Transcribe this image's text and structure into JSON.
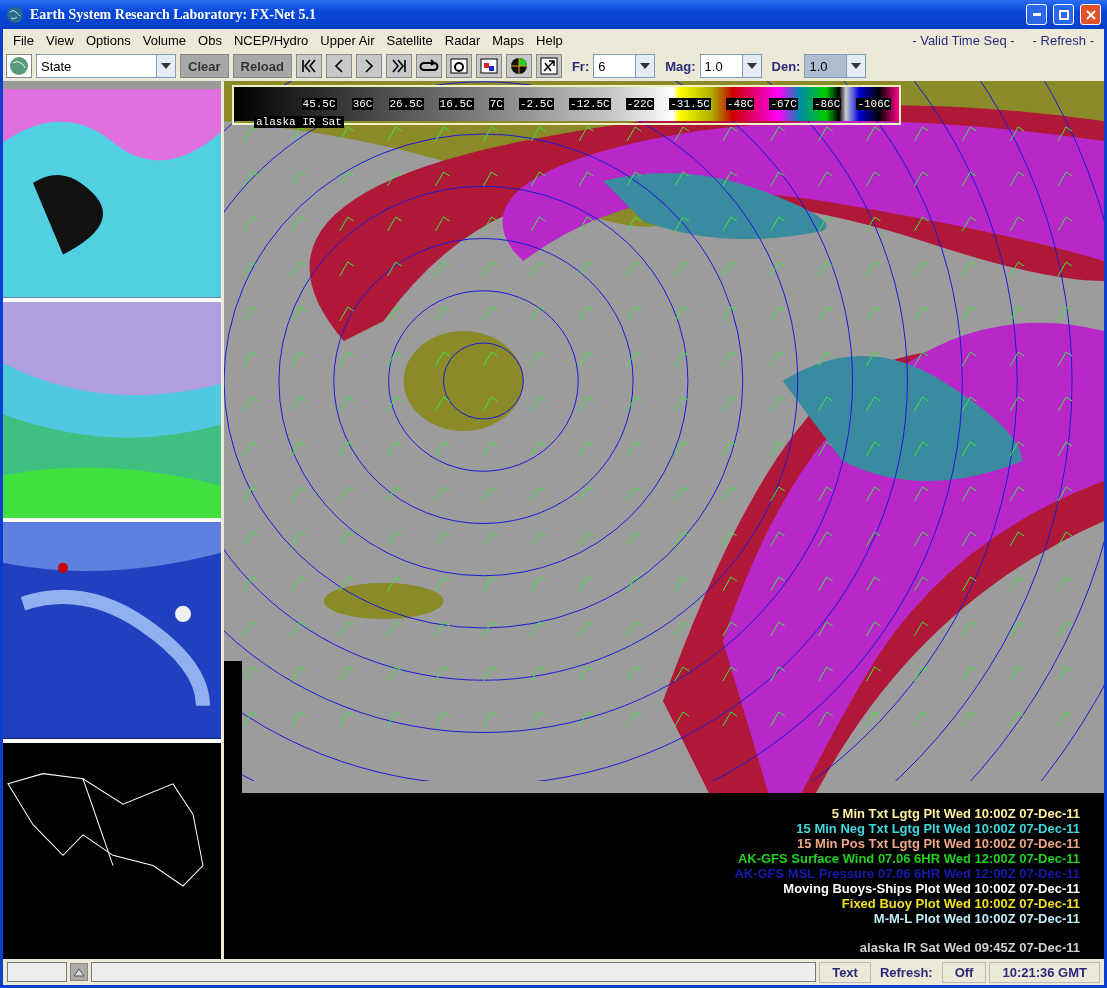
{
  "window": {
    "title": "Earth System Research Laboratory: FX-Net 5.1"
  },
  "menu": {
    "items": [
      "File",
      "View",
      "Options",
      "Volume",
      "Obs",
      "NCEP/Hydro",
      "Upper Air",
      "Satellite",
      "Radar",
      "Maps",
      "Help"
    ],
    "right": [
      "- Valid Time Seq -",
      "- Refresh -"
    ]
  },
  "toolbar": {
    "region": "State",
    "buttons": [
      "Clear",
      "Reload"
    ],
    "selectors": [
      {
        "label": "Fr:",
        "value": "6",
        "highlighted": false
      },
      {
        "label": "Mag:",
        "value": "1.0",
        "highlighted": false
      },
      {
        "label": "Den:",
        "value": "1.0",
        "highlighted": true
      }
    ]
  },
  "thumbnails": [
    {
      "kind": "wind"
    },
    {
      "kind": "temperature"
    },
    {
      "kind": "surface"
    },
    {
      "kind": "outline"
    }
  ],
  "map": {
    "colorbar": {
      "labels": [
        "45.5C",
        "36C",
        "26.5C",
        "16.5C",
        "7C",
        "-2.5C",
        "-12.5C",
        "-22C",
        "-31.5C",
        "-48C",
        "-67C",
        "-86C",
        "-106C"
      ],
      "caption": "alaska IR Sat"
    },
    "legend": [
      {
        "text": "5 Min Txt Lgtg Plt Wed 10:00Z 07-Dec-11",
        "color": "#fff0a0"
      },
      {
        "text": "15 Min Neg Txt Lgtg Plt Wed 10:00Z 07-Dec-11",
        "color": "#40d8e0"
      },
      {
        "text": "15 Min Pos Txt Lgtg Plt Wed 10:00Z 07-Dec-11",
        "color": "#f0a888"
      },
      {
        "text": "AK-GFS Surface Wind  07.06   6HR Wed 12:00Z 07-Dec-11",
        "color": "#20d020"
      },
      {
        "text": "AK-GFS MSL Pressure  07.06   6HR Wed 12:00Z 07-Dec-11",
        "color": "#1818b0"
      },
      {
        "text": "Moving Buoys-Ships Plot Wed 10:00Z 07-Dec-11",
        "color": "#ffffff"
      },
      {
        "text": "Fixed Buoy Plot Wed 10:00Z 07-Dec-11",
        "color": "#f0e020"
      },
      {
        "text": "M-M-L Plot Wed 10:00Z 07-Dec-11",
        "color": "#c0ecf8"
      }
    ],
    "footer": "alaska IR Sat Wed 09:45Z 07-Dec-11"
  },
  "status_bar": {
    "mode": "Text",
    "refresh_label": "Refresh:",
    "refresh_value": "Off",
    "clock": "10:21:36 GMT"
  }
}
